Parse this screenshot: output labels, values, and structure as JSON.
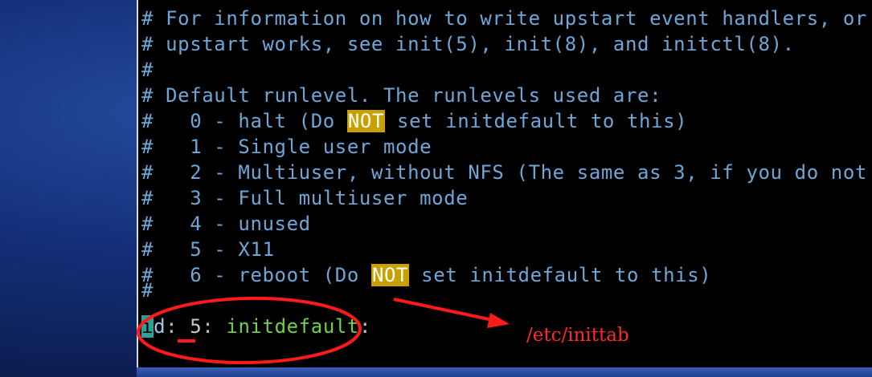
{
  "terminal": {
    "lines": [
      "# For information on how to write upstart event handlers, or",
      "# upstart works, see init(5), init(8), and initctl(8).",
      "#",
      "# Default runlevel. The runlevels used are:"
    ],
    "runlevels": [
      {
        "prefix": "#   0 - halt (Do ",
        "highlight": "NOT",
        "suffix": " set initdefault to this)"
      },
      {
        "text": "#   1 - Single user mode"
      },
      {
        "text": "#   2 - Multiuser, without NFS (The same as 3, if you do not"
      },
      {
        "text": "#   3 - Full multiuser mode"
      },
      {
        "text": "#   4 - unused"
      },
      {
        "text": "#   5 - X11"
      },
      {
        "prefix": "#   6 - reboot (Do ",
        "highlight": "NOT",
        "suffix": " set initdefault to this)"
      }
    ],
    "blank_comment": "#",
    "config": {
      "cursor_char": "i",
      "id_rest": "d",
      "colon1": ":",
      "level": "5",
      "colon2": ":",
      "action": "initdefault",
      "colon3": ":"
    }
  },
  "annotation": {
    "label": "/etc/inittab",
    "color": "#ff2a2a"
  },
  "colors": {
    "comment": "#6ea6d8",
    "highlight_bg": "#c8a000",
    "keyword": "#6fd14a",
    "cursor": "#2aa198"
  }
}
